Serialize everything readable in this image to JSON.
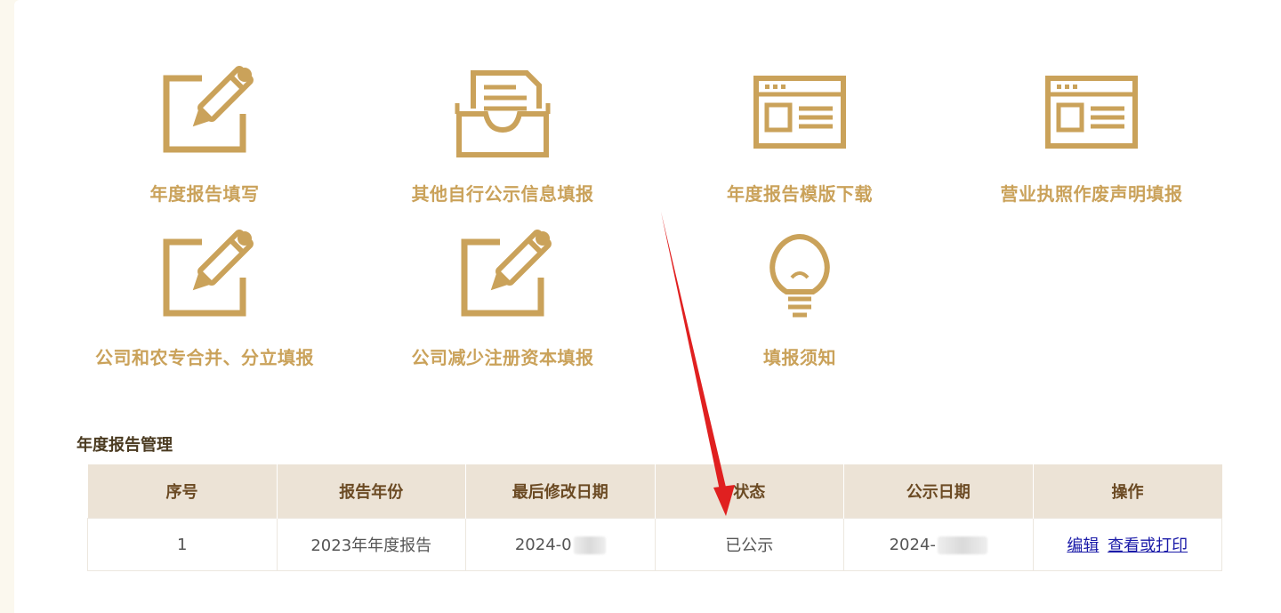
{
  "tiles": [
    {
      "label": "年度报告填写",
      "icon": "edit-pencil-icon"
    },
    {
      "label": "其他自行公示信息填报",
      "icon": "document-tray-icon"
    },
    {
      "label": "年度报告模版下载",
      "icon": "browser-window-icon"
    },
    {
      "label": "营业执照作废声明填报",
      "icon": "browser-window-icon"
    },
    {
      "label": "公司和农专合并、分立填报",
      "icon": "edit-pencil-icon"
    },
    {
      "label": "公司减少注册资本填报",
      "icon": "edit-pencil-icon"
    },
    {
      "label": "填报须知",
      "icon": "lightbulb-icon"
    }
  ],
  "section": {
    "title": "年度报告管理"
  },
  "table": {
    "headers": [
      "序号",
      "报告年份",
      "最后修改日期",
      "状态",
      "公示日期",
      "操作"
    ],
    "rows": [
      {
        "index": "1",
        "year": "2023年年度报告",
        "modified": "2024-0",
        "status": "已公示",
        "publish": "2024-",
        "edit": "编辑",
        "view": "查看或打印"
      }
    ]
  },
  "colors": {
    "accent_gold": "#caa25a",
    "header_bg": "#ece3d6",
    "annotation_arrow": "#e02020",
    "link": "#1a1aa8"
  }
}
